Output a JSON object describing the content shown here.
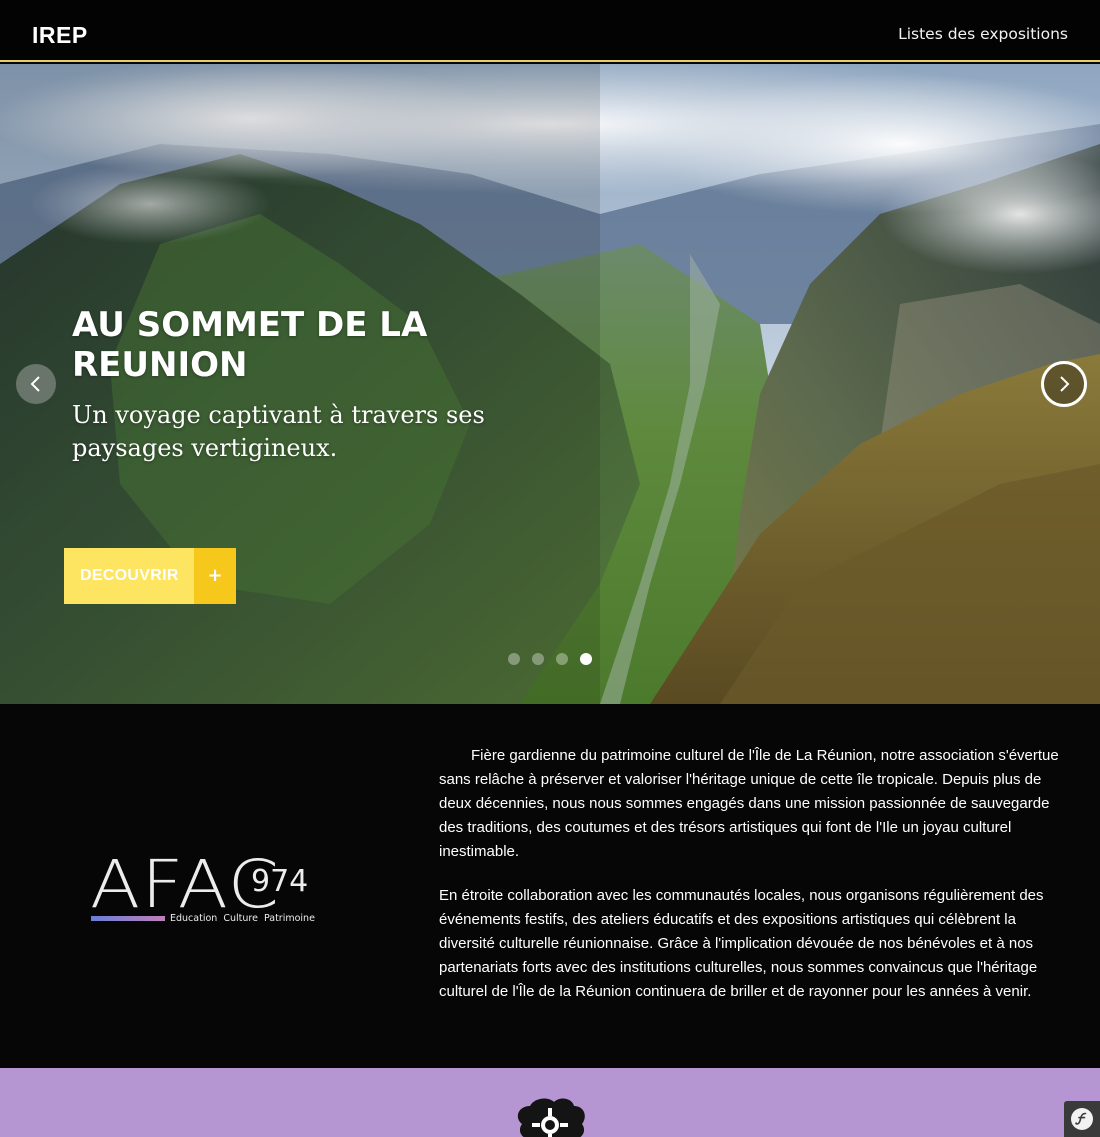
{
  "navbar": {
    "brand": "IREP",
    "link": "Listes des expositions"
  },
  "hero": {
    "title": "AU SOMMET DE LA REUNION",
    "subtitle": "Un voyage captivant à travers ses paysages vertigineux.",
    "cta_label": "DECOUVRIR",
    "cta_icon": "+",
    "slides_count": 4,
    "active_slide": 4,
    "prev_icon": "chevron-left-icon",
    "next_icon": "chevron-right-icon",
    "image": "mountain-valley-landscape"
  },
  "about": {
    "logo_text": "AFAC",
    "logo_number": "974",
    "logo_tagline": "Education  Culture  Patrimoine",
    "paragraphs": [
      "Fière gardienne du patrimoine culturel de l'Île de La Réunion, notre association s'évertue sans relâche à préserver et valoriser l'héritage unique de cette île tropicale. Depuis plus de deux décennies, nous nous sommes engagés dans une mission passionnée de sauvegarde des traditions, des coutumes et des trésors artistiques qui font de l'Ile un joyau culturel inestimable.",
      "En étroite collaboration avec les communautés locales, nous organisons régulièrement des événements festifs, des ateliers éducatifs et des expositions artistiques qui célèbrent la diversité culturelle réunionnaise. Grâce à l'implication dévouée de nos bénévoles et à nos partenariats forts avec des institutions culturelles, nous sommes convaincus que l'héritage culturel de l'Île de la Réunion continuera de briller et de rayonner pour les années à venir."
    ]
  },
  "colors": {
    "nav_border": "#e6cf63",
    "cta_primary": "#fee561",
    "cta_secondary": "#f7c81c",
    "purple_section": "#b596d3",
    "dark_bg": "#060606"
  },
  "footer": {
    "debug_icon": "symfony-icon"
  }
}
